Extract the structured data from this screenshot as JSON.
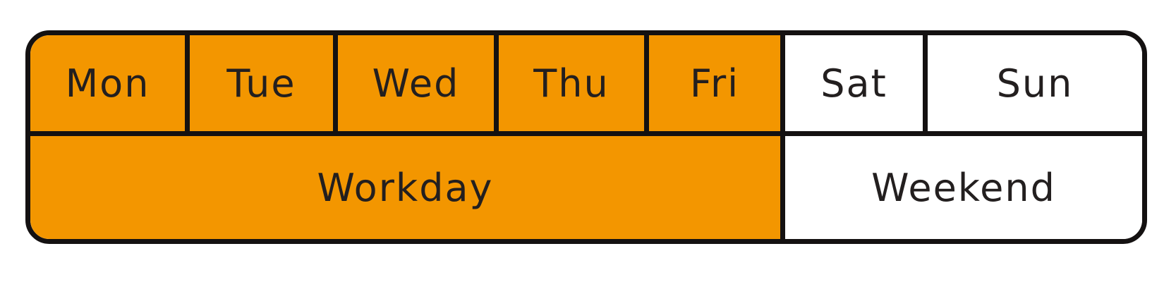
{
  "days": [
    "Mon",
    "Tue",
    "Wed",
    "Thu",
    "Fri",
    "Sat",
    "Sun"
  ],
  "groups": {
    "workday": "Workday",
    "weekend": "Weekend"
  },
  "colors": {
    "workday_fill": "#f39600",
    "weekend_fill": "#ffffff",
    "border": "#141111",
    "text": "#231f1f"
  }
}
